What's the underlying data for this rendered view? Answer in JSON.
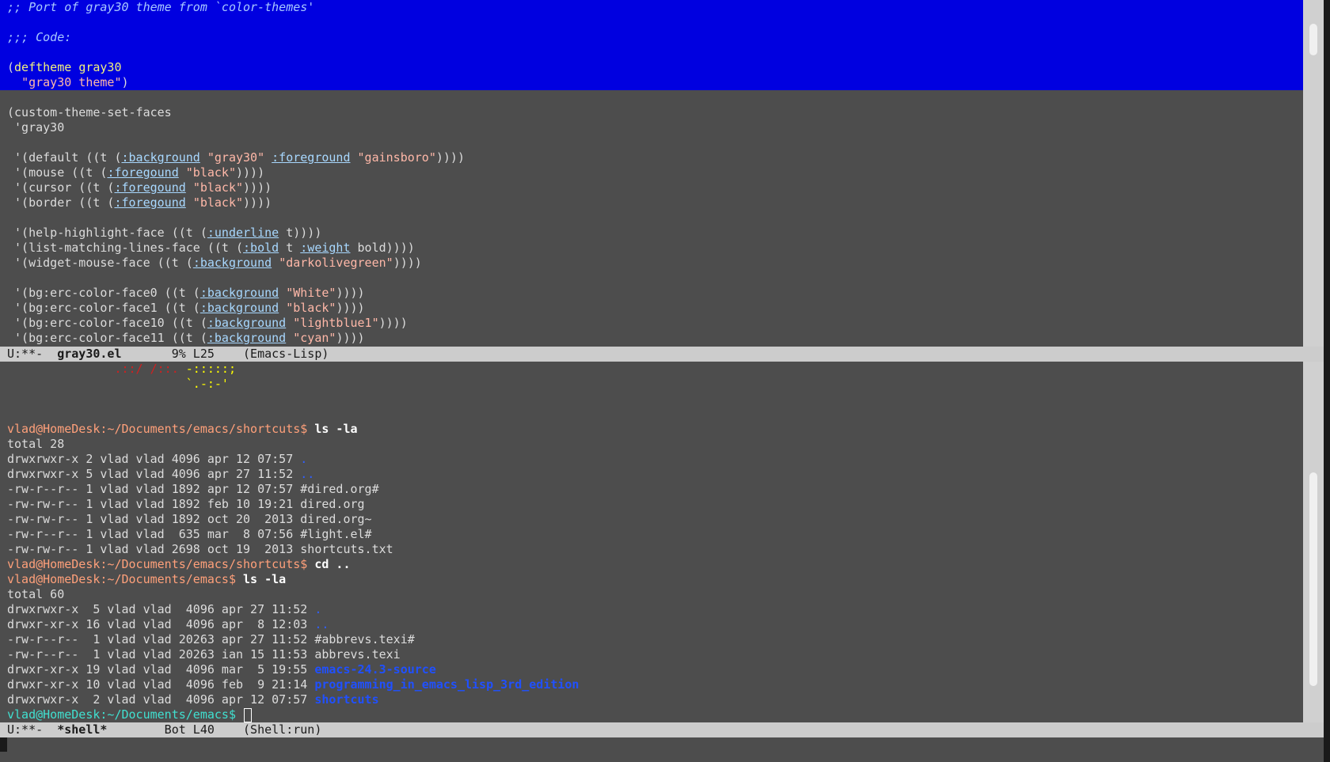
{
  "editor": {
    "lines": [
      {
        "segs": [
          {
            "t": ";; Port of gray30 theme from `color-themes'",
            "c": "comment"
          }
        ],
        "region": true
      },
      {
        "segs": [],
        "region": true
      },
      {
        "segs": [
          {
            "t": ";;; Code:",
            "c": "comment"
          }
        ],
        "region": true
      },
      {
        "segs": [],
        "region": true
      },
      {
        "segs": [
          {
            "t": "(",
            "c": ""
          },
          {
            "t": "deftheme",
            "c": "kw"
          },
          {
            "t": " ",
            "c": ""
          },
          {
            "t": "gray30",
            "c": "kw"
          }
        ],
        "region": true
      },
      {
        "segs": [
          {
            "t": "  ",
            "c": ""
          },
          {
            "t": "\"gray30 theme\"",
            "c": "str"
          },
          {
            "t": ")",
            "c": ""
          }
        ],
        "region": true
      },
      {
        "segs": []
      },
      {
        "segs": [
          {
            "t": "(custom-theme-set-faces",
            "c": ""
          }
        ]
      },
      {
        "segs": [
          {
            "t": " 'gray30",
            "c": ""
          }
        ]
      },
      {
        "segs": []
      },
      {
        "segs": [
          {
            "t": " '(default ((t (",
            "c": ""
          },
          {
            "t": ":background",
            "c": "kwd"
          },
          {
            "t": " ",
            "c": ""
          },
          {
            "t": "\"gray30\"",
            "c": "str"
          },
          {
            "t": " ",
            "c": ""
          },
          {
            "t": ":foreground",
            "c": "kwd"
          },
          {
            "t": " ",
            "c": ""
          },
          {
            "t": "\"gainsboro\"",
            "c": "str"
          },
          {
            "t": "))))",
            "c": ""
          }
        ]
      },
      {
        "segs": [
          {
            "t": " '(mouse ((t (",
            "c": ""
          },
          {
            "t": ":foregound",
            "c": "kwd"
          },
          {
            "t": " ",
            "c": ""
          },
          {
            "t": "\"black\"",
            "c": "str"
          },
          {
            "t": "))))",
            "c": ""
          }
        ]
      },
      {
        "segs": [
          {
            "t": " '(cursor ((t (",
            "c": ""
          },
          {
            "t": ":foregound",
            "c": "kwd"
          },
          {
            "t": " ",
            "c": ""
          },
          {
            "t": "\"black\"",
            "c": "str"
          },
          {
            "t": "))))",
            "c": ""
          }
        ]
      },
      {
        "segs": [
          {
            "t": " '(border ((t (",
            "c": ""
          },
          {
            "t": ":foregound",
            "c": "kwd"
          },
          {
            "t": " ",
            "c": ""
          },
          {
            "t": "\"black\"",
            "c": "str"
          },
          {
            "t": "))))",
            "c": ""
          }
        ]
      },
      {
        "segs": []
      },
      {
        "segs": [
          {
            "t": " '(help-highlight-face ((t (",
            "c": ""
          },
          {
            "t": ":underline",
            "c": "kwd"
          },
          {
            "t": " t))))",
            "c": ""
          }
        ]
      },
      {
        "segs": [
          {
            "t": " '(list-matching-lines-face ((t (",
            "c": ""
          },
          {
            "t": ":bold",
            "c": "kwd"
          },
          {
            "t": " t ",
            "c": ""
          },
          {
            "t": ":weight",
            "c": "kwd"
          },
          {
            "t": " bold))))",
            "c": ""
          }
        ]
      },
      {
        "segs": [
          {
            "t": " '(widget-mouse-face ((t (",
            "c": ""
          },
          {
            "t": ":background",
            "c": "kwd"
          },
          {
            "t": " ",
            "c": ""
          },
          {
            "t": "\"darkolivegreen\"",
            "c": "str"
          },
          {
            "t": "))))",
            "c": ""
          }
        ]
      },
      {
        "segs": []
      },
      {
        "segs": [
          {
            "t": " '(bg:erc-color-face0 ((t (",
            "c": ""
          },
          {
            "t": ":background",
            "c": "kwd"
          },
          {
            "t": " ",
            "c": ""
          },
          {
            "t": "\"White\"",
            "c": "str"
          },
          {
            "t": "))))",
            "c": ""
          }
        ]
      },
      {
        "segs": [
          {
            "t": " '(bg:erc-color-face1 ((t (",
            "c": ""
          },
          {
            "t": ":background",
            "c": "kwd"
          },
          {
            "t": " ",
            "c": ""
          },
          {
            "t": "\"black\"",
            "c": "str"
          },
          {
            "t": "))))",
            "c": ""
          }
        ]
      },
      {
        "segs": [
          {
            "t": " '(bg:erc-color-face10 ((t (",
            "c": ""
          },
          {
            "t": ":background",
            "c": "kwd"
          },
          {
            "t": " ",
            "c": ""
          },
          {
            "t": "\"lightblue1\"",
            "c": "str"
          },
          {
            "t": "))))",
            "c": ""
          }
        ]
      },
      {
        "segs": [
          {
            "t": " '(bg:erc-color-face11 ((t (",
            "c": ""
          },
          {
            "t": ":background",
            "c": "kwd"
          },
          {
            "t": " ",
            "c": ""
          },
          {
            "t": "\"cyan\"",
            "c": "str"
          },
          {
            "t": "))))",
            "c": ""
          }
        ]
      }
    ]
  },
  "modeline1": {
    "status": "U:**-  ",
    "buffer": "gray30.el",
    "position": "       9% L25    ",
    "mode": "(Emacs-Lisp)"
  },
  "shell": {
    "lines": [
      {
        "segs": [
          {
            "t": "               ",
            "c": ""
          },
          {
            "t": ".::/ /::.",
            "c": "red"
          },
          {
            "t": " ",
            "c": ""
          },
          {
            "t": "-:::::;",
            "c": "yel"
          }
        ]
      },
      {
        "segs": [
          {
            "t": "                         ",
            "c": ""
          },
          {
            "t": "`.-:-'",
            "c": "yel"
          }
        ]
      },
      {
        "segs": []
      },
      {
        "segs": []
      },
      {
        "segs": [
          {
            "t": "vlad@HomeDesk:~/Documents/emacs/shortcuts$ ",
            "c": "prompt"
          },
          {
            "t": "ls -la",
            "c": "cmd"
          }
        ]
      },
      {
        "segs": [
          {
            "t": "total 28",
            "c": ""
          }
        ]
      },
      {
        "segs": [
          {
            "t": "drwxrwxr-x 2 vlad vlad 4096 apr 12 07:57 ",
            "c": ""
          },
          {
            "t": ".",
            "c": "dir"
          }
        ]
      },
      {
        "segs": [
          {
            "t": "drwxrwxr-x 5 vlad vlad 4096 apr 27 11:52 ",
            "c": ""
          },
          {
            "t": "..",
            "c": "dir"
          }
        ]
      },
      {
        "segs": [
          {
            "t": "-rw-r--r-- 1 vlad vlad 1892 apr 12 07:57 #dired.org#",
            "c": ""
          }
        ]
      },
      {
        "segs": [
          {
            "t": "-rw-rw-r-- 1 vlad vlad 1892 feb 10 19:21 dired.org",
            "c": ""
          }
        ]
      },
      {
        "segs": [
          {
            "t": "-rw-rw-r-- 1 vlad vlad 1892 oct 20  2013 dired.org~",
            "c": ""
          }
        ]
      },
      {
        "segs": [
          {
            "t": "-rw-r--r-- 1 vlad vlad  635 mar  8 07:56 #light.el#",
            "c": ""
          }
        ]
      },
      {
        "segs": [
          {
            "t": "-rw-rw-r-- 1 vlad vlad 2698 oct 19  2013 shortcuts.txt",
            "c": ""
          }
        ]
      },
      {
        "segs": [
          {
            "t": "vlad@HomeDesk:~/Documents/emacs/shortcuts$ ",
            "c": "prompt"
          },
          {
            "t": "cd ..",
            "c": "cmd"
          }
        ]
      },
      {
        "segs": [
          {
            "t": "vlad@HomeDesk:~/Documents/emacs$ ",
            "c": "prompt"
          },
          {
            "t": "ls -la",
            "c": "cmd"
          }
        ]
      },
      {
        "segs": [
          {
            "t": "total 60",
            "c": ""
          }
        ]
      },
      {
        "segs": [
          {
            "t": "drwxrwxr-x  5 vlad vlad  4096 apr 27 11:52 ",
            "c": ""
          },
          {
            "t": ".",
            "c": "dir"
          }
        ]
      },
      {
        "segs": [
          {
            "t": "drwxr-xr-x 16 vlad vlad  4096 apr  8 12:03 ",
            "c": ""
          },
          {
            "t": "..",
            "c": "dir"
          }
        ]
      },
      {
        "segs": [
          {
            "t": "-rw-r--r--  1 vlad vlad 20263 apr 27 11:52 #abbrevs.texi#",
            "c": ""
          }
        ]
      },
      {
        "segs": [
          {
            "t": "-rw-r--r--  1 vlad vlad 20263 ian 15 11:53 abbrevs.texi",
            "c": ""
          }
        ]
      },
      {
        "segs": [
          {
            "t": "drwxr-xr-x 19 vlad vlad  4096 mar  5 19:55 ",
            "c": ""
          },
          {
            "t": "emacs-24.3-source",
            "c": "dirb"
          }
        ]
      },
      {
        "segs": [
          {
            "t": "drwxr-xr-x 10 vlad vlad  4096 feb  9 21:14 ",
            "c": ""
          },
          {
            "t": "programming_in_emacs_lisp_3rd_edition",
            "c": "dirb"
          }
        ]
      },
      {
        "segs": [
          {
            "t": "drwxrwxr-x  2 vlad vlad  4096 apr 12 07:57 ",
            "c": ""
          },
          {
            "t": "shortcuts",
            "c": "dirb"
          }
        ]
      }
    ],
    "current_prompt": "vlad@HomeDesk:~/Documents/emacs$ "
  },
  "modeline2": {
    "status": "U:**-  ",
    "buffer": "*shell*",
    "position": "        Bot L40    ",
    "mode": "(Shell:run)"
  }
}
